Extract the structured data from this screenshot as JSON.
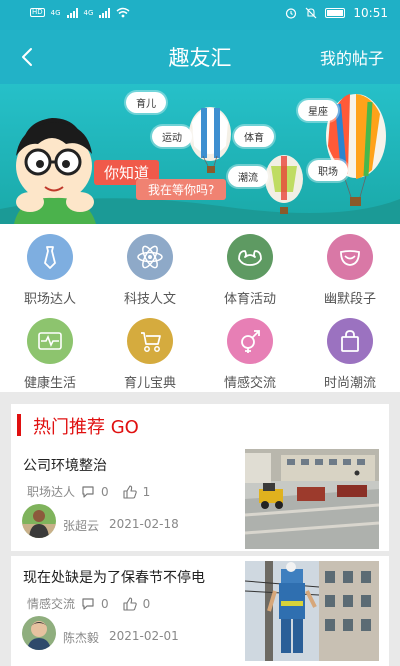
{
  "status_bar": {
    "sim_tags": [
      "HD",
      "HD"
    ],
    "network_labels": [
      "4G",
      "4G"
    ],
    "time": "10:51"
  },
  "header": {
    "title": "趣友汇",
    "right_action": "我的帖子"
  },
  "banner": {
    "bubbles": [
      "育儿",
      "运动",
      "体育",
      "星座",
      "潮流",
      "职场"
    ],
    "headline": "你知道",
    "subline": "我在等你吗?"
  },
  "categories": [
    {
      "label": "职场达人",
      "icon": "tie-icon",
      "color": "#7eaee0"
    },
    {
      "label": "科技人文",
      "icon": "atom-icon",
      "color": "#8ea9c8"
    },
    {
      "label": "体育活动",
      "icon": "muscle-icon",
      "color": "#5e9a62"
    },
    {
      "label": "幽默段子",
      "icon": "smile-icon",
      "color": "#d978a6"
    },
    {
      "label": "健康生活",
      "icon": "heartbeat-icon",
      "color": "#8dc46e"
    },
    {
      "label": "育儿宝典",
      "icon": "stroller-icon",
      "color": "#d5ab3e"
    },
    {
      "label": "情感交流",
      "icon": "gender-icon",
      "color": "#e77fb5"
    },
    {
      "label": "时尚潮流",
      "icon": "shopping-bag-icon",
      "color": "#9b72c0"
    }
  ],
  "hot_section": {
    "title": "热门推荐 GO"
  },
  "posts": [
    {
      "title": "公司环境整治",
      "category": "职场达人",
      "comments": "0",
      "likes": "1",
      "author": "张超云",
      "date": "2021-02-18"
    },
    {
      "title": "现在处缺是为了保春节不停电",
      "category": "情感交流",
      "comments": "0",
      "likes": "0",
      "author": "陈杰毅",
      "date": "2021-02-01"
    }
  ]
}
